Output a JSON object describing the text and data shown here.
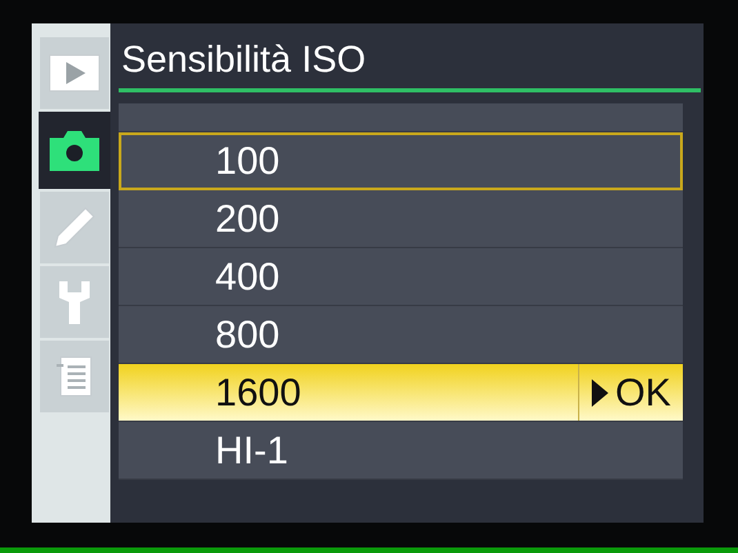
{
  "title": "Sensibilità ISO",
  "tabs": [
    {
      "kind": "play",
      "selected": false
    },
    {
      "kind": "camera",
      "selected": true
    },
    {
      "kind": "pencil",
      "selected": false
    },
    {
      "kind": "wrench",
      "selected": false
    },
    {
      "kind": "list",
      "selected": false
    }
  ],
  "options": [
    {
      "label": "100",
      "current": true,
      "selected": false
    },
    {
      "label": "200",
      "current": false,
      "selected": false
    },
    {
      "label": "400",
      "current": false,
      "selected": false
    },
    {
      "label": "800",
      "current": false,
      "selected": false
    },
    {
      "label": "1600",
      "current": false,
      "selected": true,
      "hint": "OK"
    },
    {
      "label": "HI-1",
      "current": false,
      "selected": false
    }
  ]
}
